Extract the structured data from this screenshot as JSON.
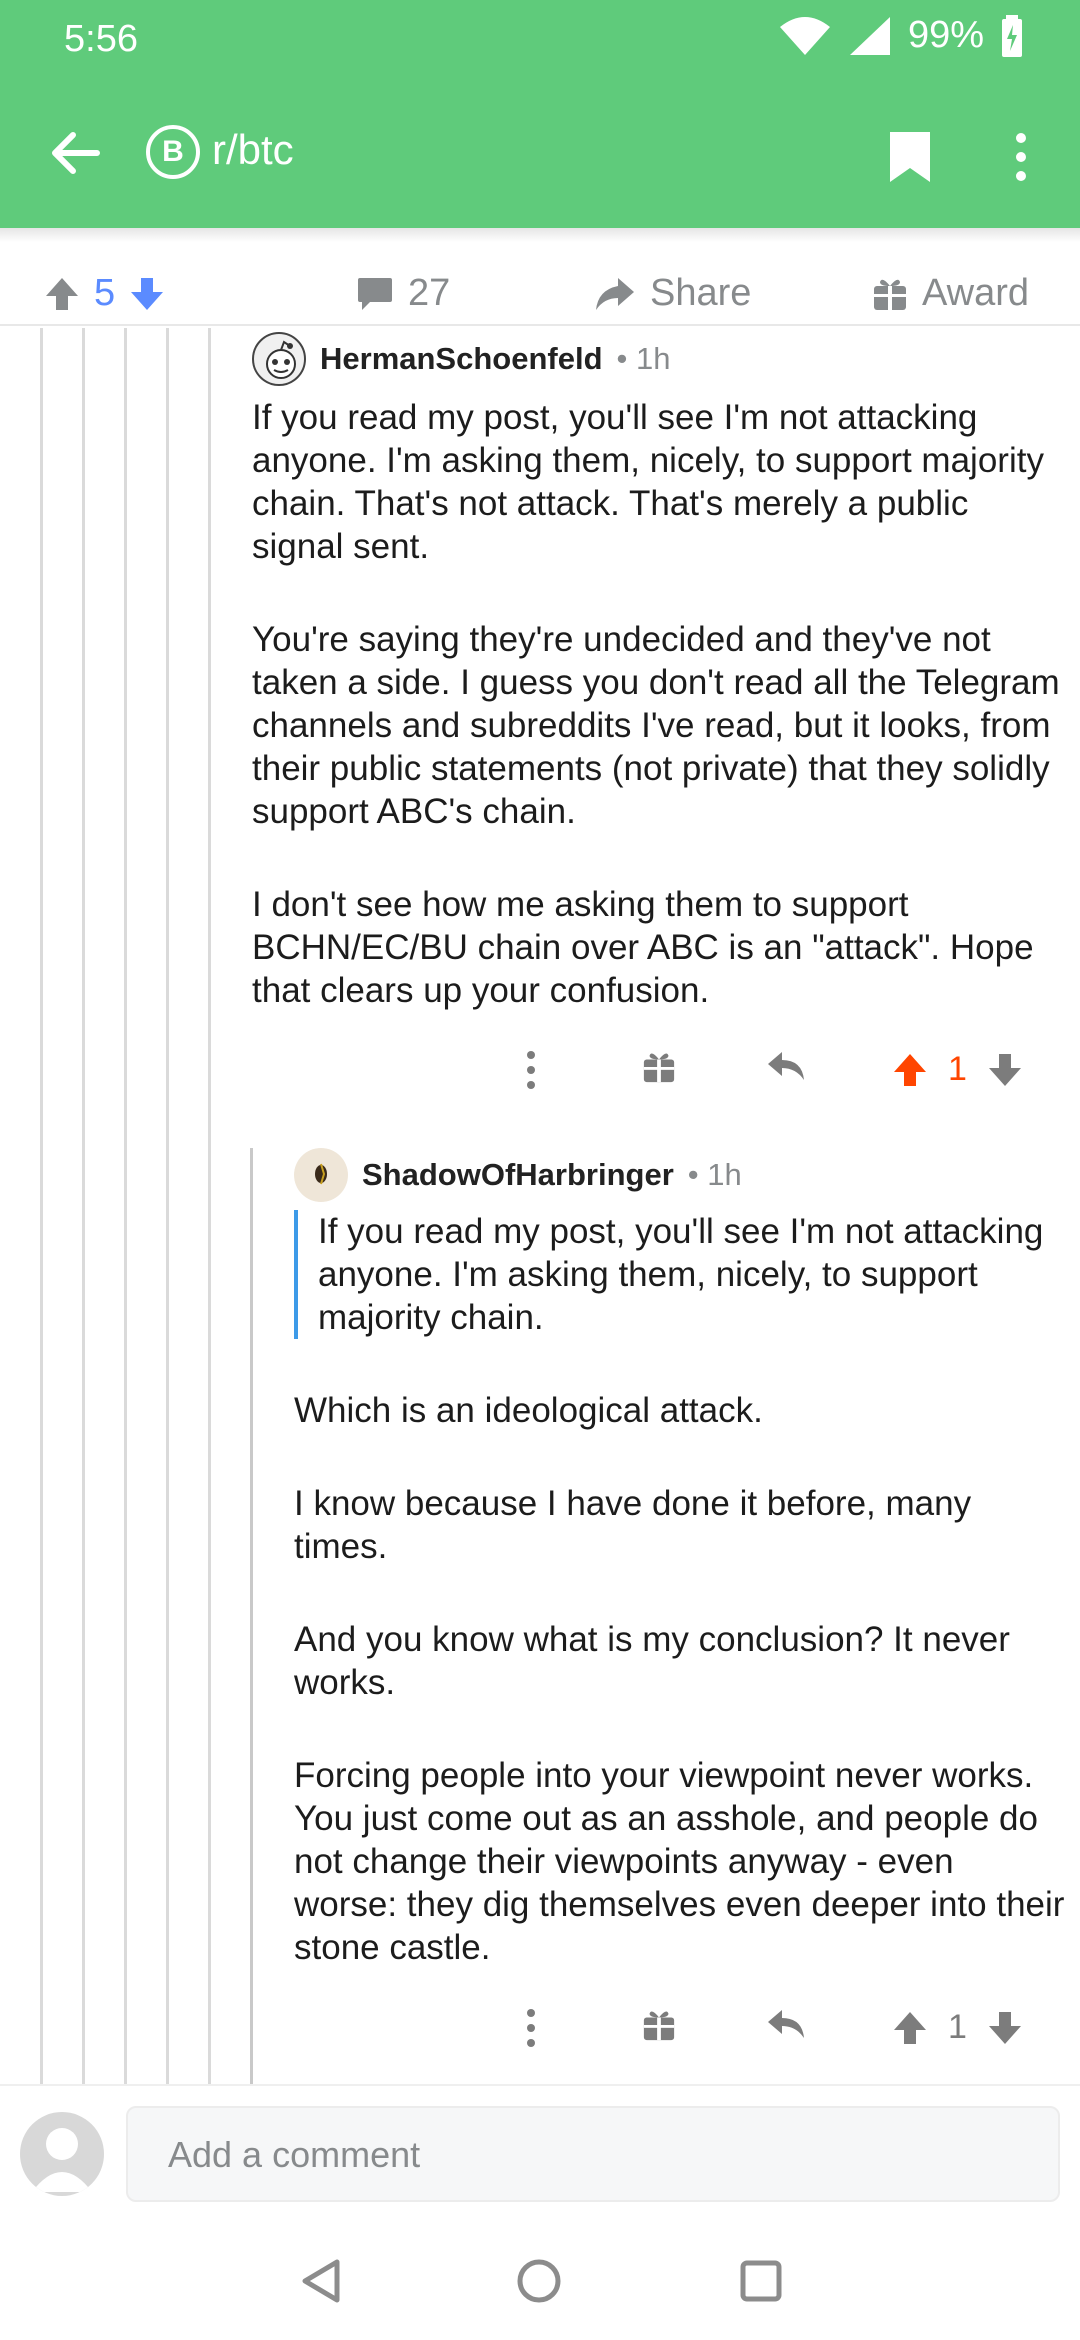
{
  "status_bar": {
    "time": "5:56",
    "battery": "99%"
  },
  "app_bar": {
    "subreddit": "r/btc",
    "sub_icon_glyph": "B"
  },
  "post_actions": {
    "votes": "5",
    "comments": "27",
    "share_label": "Share",
    "award_label": "Award"
  },
  "comments": [
    {
      "author": "HermanSchoenfeld",
      "age": "• 1h",
      "paragraphs": [
        "If you read my post, you'll see I'm not attacking anyone. I'm asking them, nicely, to support majority chain. That's not attack. That's merely a public signal sent.",
        "You're saying they're undecided and they've not taken a side. I guess you don't read all the Telegram channels and subreddits I've read, but it looks, from their public statements (not private) that they solidly support ABC's chain.",
        "I don't see how me asking them to support BCHN/EC/BU chain over ABC is an \"attack\". Hope that clears up your confusion."
      ],
      "score": "1"
    },
    {
      "author": "ShadowOfHarbringer",
      "age": "• 1h",
      "quote": "If you read my post, you'll see I'm not attacking anyone. I'm asking them, nicely, to support majority chain.",
      "paragraphs": [
        "Which is an ideological attack.",
        "I know because I have done it before, many times.",
        "And you know what is my conclusion? It never works.",
        "Forcing people into your viewpoint never works. You just come out as an asshole, and people do not change their viewpoints anyway - even worse: they dig themselves even deeper into their stone castle."
      ],
      "score": "1"
    }
  ],
  "compose": {
    "placeholder": "Add a comment"
  },
  "colors": {
    "header_green": "#5fcb7b",
    "upvote_orange": "#ff4500",
    "vote_blue": "#5b8bff",
    "quote_blue": "#3d9ae8"
  }
}
